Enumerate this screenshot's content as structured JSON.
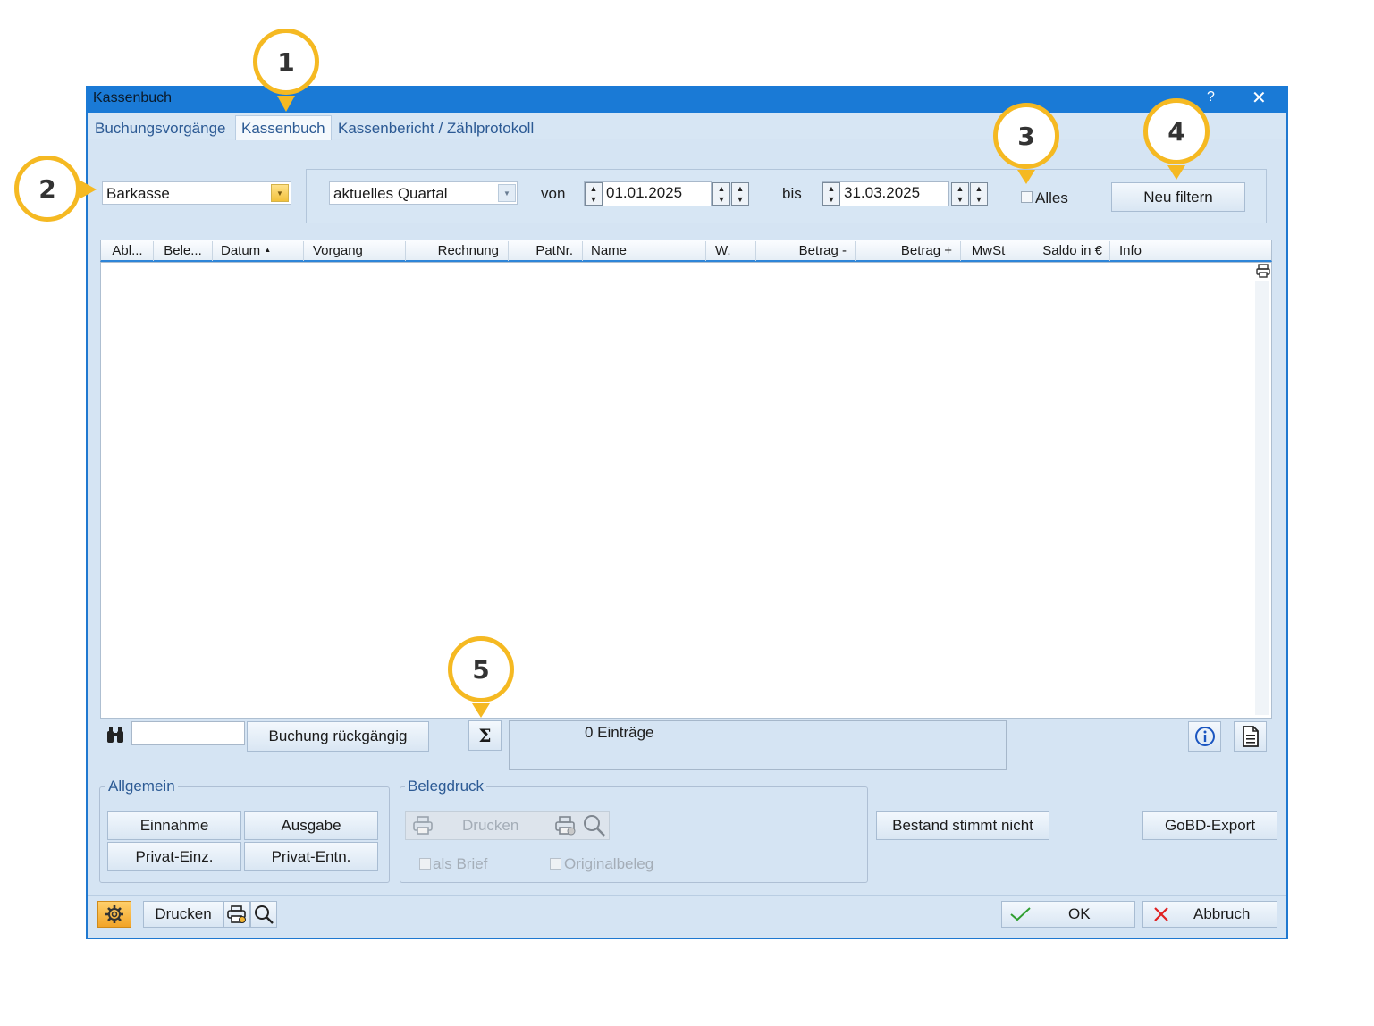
{
  "window": {
    "title": "Kassenbuch",
    "help_label": "?",
    "close_label": "✕"
  },
  "tabs": [
    {
      "label": "Buchungsvorgänge",
      "active": false
    },
    {
      "label": "Kassenbuch",
      "active": true
    },
    {
      "label": "Kassenbericht / Zählprotokoll",
      "active": false
    }
  ],
  "filter": {
    "account": "Barkasse",
    "period": "aktuelles Quartal",
    "from_label": "von",
    "from_date": "01.01.2025",
    "to_label": "bis",
    "to_date": "31.03.2025",
    "all_label": "Alles",
    "all_checked": false,
    "refilter_button": "Neu filtern"
  },
  "grid": {
    "columns": [
      "Abl...",
      "Bele...",
      "Datum",
      "Vorgang",
      "Rechnung",
      "PatNr.",
      "Name",
      "W.",
      "Betrag -",
      "Betrag +",
      "MwSt",
      "Saldo in €",
      "Info"
    ],
    "sort_indicator": "▲",
    "rows": []
  },
  "toolbar": {
    "search_value": "",
    "undo_button": "Buchung rückgängig",
    "sum_button": "Σ",
    "entries_text": "0 Einträge"
  },
  "general_group": {
    "title": "Allgemein",
    "buttons": [
      "Einnahme",
      "Ausgabe",
      "Privat-Einz.",
      "Privat-Entn."
    ]
  },
  "receipt_group": {
    "title": "Belegdruck",
    "print_label": "Drucken",
    "as_letter_label": "als Brief",
    "original_label": "Originalbeleg"
  },
  "actions": {
    "stock_mismatch": "Bestand stimmt nicht",
    "gobd_export": "GoBD-Export"
  },
  "footer": {
    "print_label": "Drucken",
    "ok_label": "OK",
    "cancel_label": "Abbruch"
  },
  "callouts": [
    "1",
    "2",
    "3",
    "4",
    "5"
  ],
  "colors": {
    "titlebar": "#1a7ad6",
    "callout_ring": "#f5b922",
    "tab_text": "#2c5a94",
    "ok_check": "#2e9e2e",
    "cancel_x": "#e02020"
  }
}
